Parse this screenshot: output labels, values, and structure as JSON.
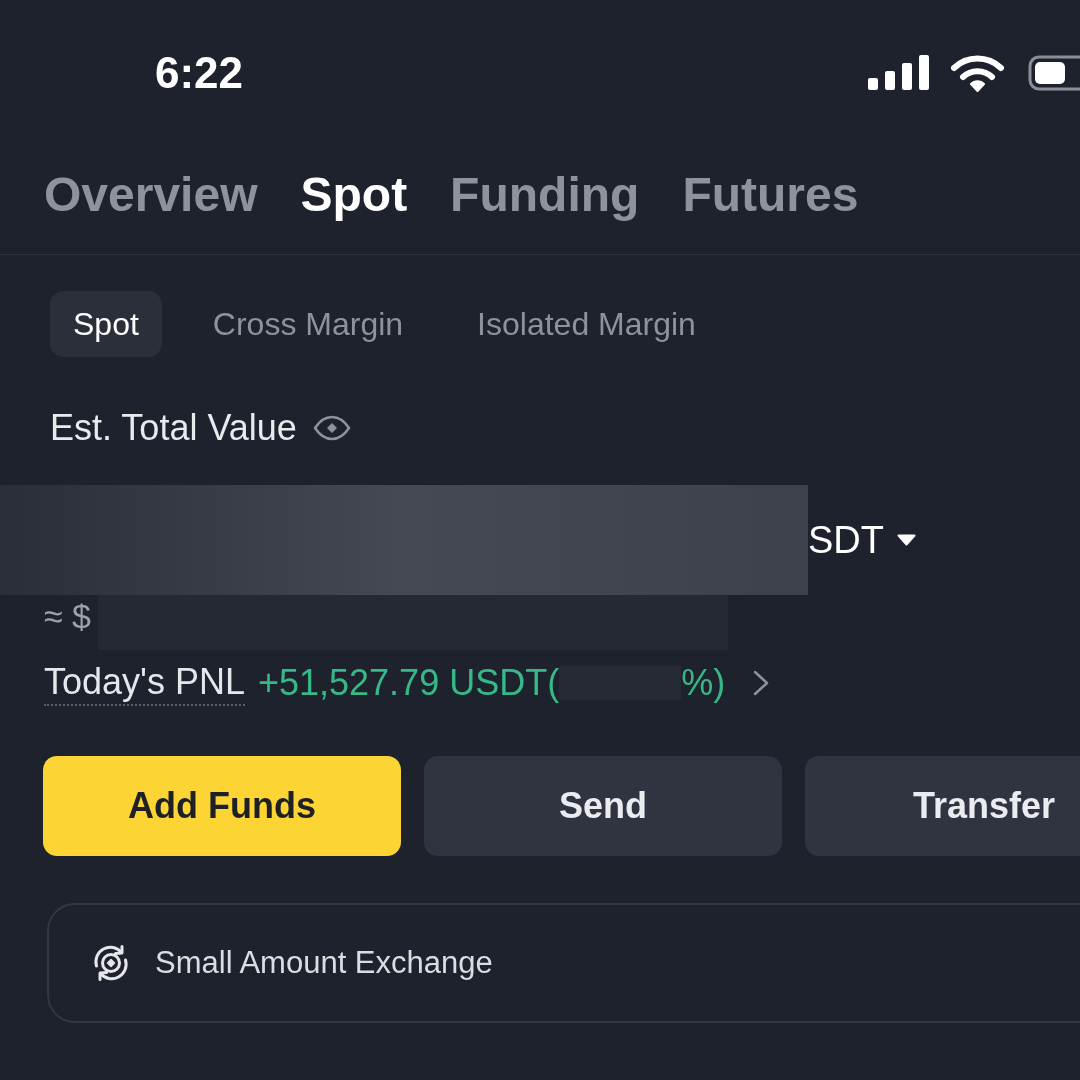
{
  "status_bar": {
    "time": "6:22"
  },
  "account_tabs": [
    {
      "label": "Overview",
      "selected": false
    },
    {
      "label": "Spot",
      "selected": true
    },
    {
      "label": "Funding",
      "selected": false
    },
    {
      "label": "Futures",
      "selected": false
    }
  ],
  "wallet_tabs": [
    {
      "label": "Spot",
      "selected": true
    },
    {
      "label": "Cross Margin",
      "selected": false
    },
    {
      "label": "Isolated Margin",
      "selected": false
    }
  ],
  "balance": {
    "label": "Est. Total Value",
    "currency": "SDT",
    "approx_prefix": "≈ $"
  },
  "pnl": {
    "label": "Today's PNL",
    "amount": "+51,527.79 USDT(",
    "suffix": "%)"
  },
  "actions": [
    {
      "label": "Add Funds",
      "kind": "primary"
    },
    {
      "label": "Send",
      "kind": "secondary"
    },
    {
      "label": "Transfer",
      "kind": "secondary"
    }
  ],
  "shortcut": {
    "label": "Small Amount Exchange"
  }
}
